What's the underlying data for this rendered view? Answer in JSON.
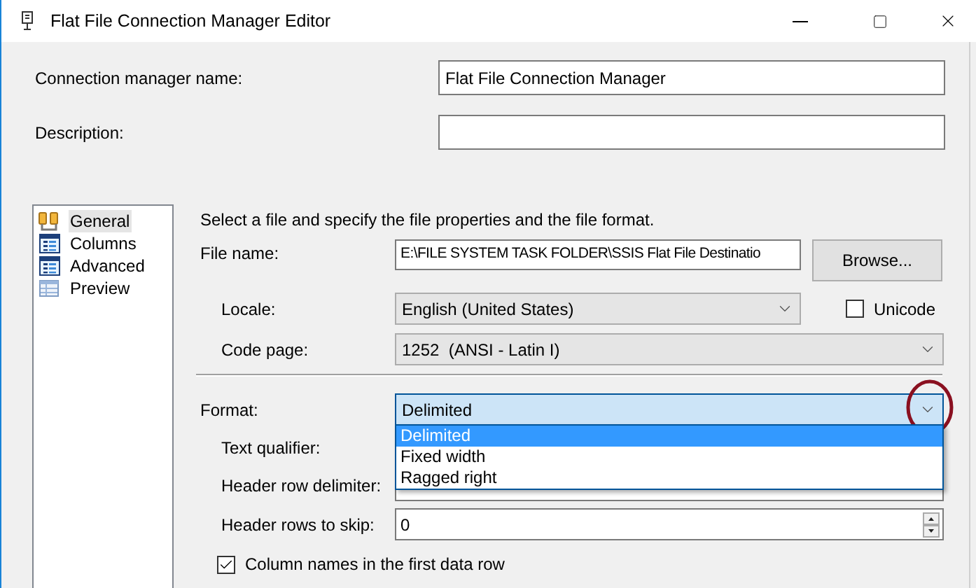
{
  "window": {
    "title": "Flat File Connection Manager Editor"
  },
  "connection_manager_name": {
    "label": "Connection manager name:",
    "value": "Flat File Connection Manager"
  },
  "description": {
    "label": "Description:"
  },
  "sidebar": {
    "items": [
      {
        "label": "General",
        "selected": true,
        "kind": "general"
      },
      {
        "label": "Columns",
        "selected": false,
        "kind": "grid"
      },
      {
        "label": "Advanced",
        "selected": false,
        "kind": "grid"
      },
      {
        "label": "Preview",
        "selected": false,
        "kind": "preview"
      }
    ]
  },
  "instructions": "Select a file and specify the file properties and the file format.",
  "file_name": {
    "label": "File name:",
    "value": "E:\\FILE SYSTEM TASK FOLDER\\SSIS Flat File Destinatio"
  },
  "browse_button": "Browse...",
  "locale": {
    "label": "Locale:",
    "value": "English (United States)"
  },
  "unicode": {
    "label": "Unicode",
    "checked": false
  },
  "code_page": {
    "label": "Code page:",
    "value": "1252  (ANSI - Latin I)"
  },
  "format": {
    "label": "Format:",
    "value": "Delimited",
    "expanded": true,
    "options": [
      {
        "label": "Delimited",
        "selected": true
      },
      {
        "label": "Fixed width",
        "selected": false
      },
      {
        "label": "Ragged right",
        "selected": false
      }
    ]
  },
  "text_qualifier": {
    "label": "Text qualifier:"
  },
  "header_row_delimiter": {
    "label": "Header row delimiter:"
  },
  "header_rows_to_skip": {
    "label": "Header rows to skip:",
    "value": "0"
  },
  "column_names_in_first_row": {
    "label": "Column names in the first data row",
    "checked": true
  }
}
